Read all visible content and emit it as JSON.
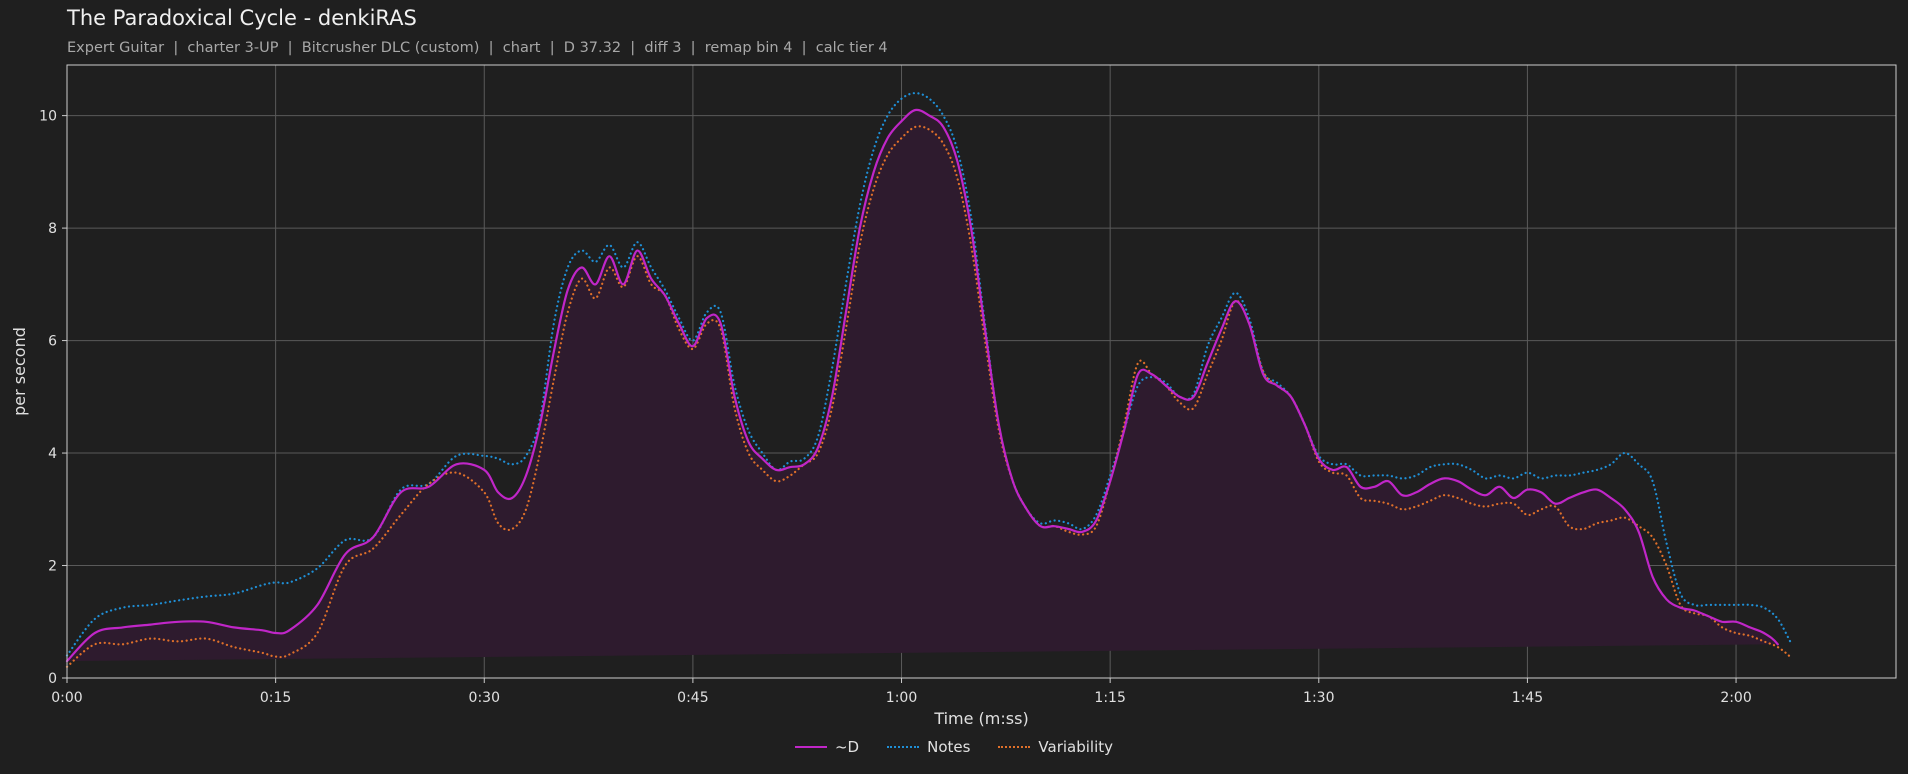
{
  "header": {
    "title": "The Paradoxical Cycle - denkiRAS",
    "subtitle": "Expert Guitar  |  charter 3-UP  |  Bitcrusher DLC (custom)  |  chart  |  D 37.32  |  diff 3  |  remap bin 4  |  calc tier 4"
  },
  "chart_data": {
    "type": "line",
    "xlabel": "Time (m:ss)",
    "ylabel": "per second",
    "xlim": [
      0,
      131.5
    ],
    "ylim": [
      0,
      10.9
    ],
    "x_ticks": [
      0,
      15,
      30,
      45,
      60,
      75,
      90,
      105,
      120
    ],
    "x_tick_labels": [
      "0:00",
      "0:15",
      "0:30",
      "0:45",
      "1:00",
      "1:15",
      "1:30",
      "1:45",
      "2:00"
    ],
    "y_ticks": [
      0,
      2,
      4,
      6,
      8,
      10
    ],
    "y_tick_labels": [
      "0",
      "2",
      "4",
      "6",
      "8",
      "10"
    ],
    "grid": true,
    "legend_position": "bottom-center",
    "x": [
      0,
      2,
      4,
      6,
      8,
      10,
      12,
      14,
      15,
      16,
      18,
      20,
      22,
      24,
      26,
      28,
      30,
      31,
      32,
      33,
      34,
      35,
      36,
      37,
      38,
      39,
      40,
      41,
      42,
      43,
      44,
      45,
      46,
      47,
      48,
      49,
      50,
      51,
      52,
      53,
      54,
      55,
      56,
      57,
      58,
      59,
      60,
      61,
      62,
      63,
      64,
      65,
      66,
      67,
      68,
      69,
      70,
      71,
      72,
      73,
      74,
      75,
      76,
      77,
      78,
      79,
      80,
      81,
      82,
      83,
      84,
      85,
      86,
      87,
      88,
      89,
      90,
      91,
      92,
      93,
      94,
      95,
      96,
      97,
      98,
      99,
      100,
      101,
      102,
      103,
      104,
      105,
      106,
      107,
      108,
      109,
      110,
      111,
      112,
      113,
      114,
      115,
      116,
      117,
      118,
      119,
      120,
      121,
      122,
      123,
      124,
      125,
      126,
      127,
      128,
      129,
      130,
      131.5
    ],
    "series": [
      {
        "name": "~D",
        "color": "#c026c8",
        "style": "solid",
        "fill": "#2e1b2e",
        "values": [
          0.3,
          0.8,
          0.9,
          0.95,
          1.0,
          1.0,
          0.9,
          0.85,
          0.8,
          0.85,
          1.3,
          2.2,
          2.5,
          3.3,
          3.4,
          3.8,
          3.7,
          3.3,
          3.2,
          3.6,
          4.5,
          5.8,
          6.9,
          7.3,
          7.0,
          7.5,
          7.0,
          7.6,
          7.1,
          6.8,
          6.3,
          5.9,
          6.4,
          6.3,
          5.0,
          4.2,
          3.9,
          3.7,
          3.75,
          3.8,
          4.1,
          5.0,
          6.5,
          8.0,
          9.0,
          9.6,
          9.9,
          10.1,
          10.0,
          9.8,
          9.2,
          8.0,
          6.2,
          4.5,
          3.5,
          3.0,
          2.7,
          2.7,
          2.65,
          2.6,
          2.8,
          3.5,
          4.4,
          5.4,
          5.4,
          5.2,
          5.0,
          5.0,
          5.6,
          6.2,
          6.7,
          6.3,
          5.4,
          5.2,
          5.0,
          4.5,
          3.9,
          3.7,
          3.75,
          3.4,
          3.4,
          3.5,
          3.25,
          3.3,
          3.45,
          3.55,
          3.5,
          3.35,
          3.25,
          3.4,
          3.2,
          3.35,
          3.3,
          3.1,
          3.2,
          3.3,
          3.35,
          3.2,
          3.0,
          2.6,
          1.8,
          1.4,
          1.25,
          1.2,
          1.1,
          1.0,
          1.0,
          0.9,
          0.8,
          0.6,
          0.15
        ]
      },
      {
        "name": "Notes",
        "color": "#1f8fd6",
        "style": "dotted",
        "values": [
          0.4,
          1.05,
          1.25,
          1.3,
          1.38,
          1.45,
          1.5,
          1.65,
          1.7,
          1.7,
          1.95,
          2.45,
          2.5,
          3.35,
          3.45,
          3.95,
          3.95,
          3.9,
          3.8,
          3.95,
          4.6,
          6.3,
          7.3,
          7.6,
          7.4,
          7.7,
          7.3,
          7.75,
          7.3,
          6.9,
          6.4,
          6.0,
          6.5,
          6.5,
          5.2,
          4.4,
          4.0,
          3.7,
          3.85,
          3.9,
          4.3,
          5.5,
          7.0,
          8.4,
          9.4,
          10.0,
          10.3,
          10.4,
          10.3,
          10.0,
          9.4,
          8.2,
          6.3,
          4.5,
          3.5,
          3.0,
          2.75,
          2.8,
          2.75,
          2.65,
          2.9,
          3.6,
          4.4,
          5.2,
          5.35,
          5.25,
          5.0,
          5.05,
          5.9,
          6.4,
          6.85,
          6.4,
          5.45,
          5.25,
          5.0,
          4.5,
          3.95,
          3.8,
          3.8,
          3.6,
          3.6,
          3.6,
          3.55,
          3.6,
          3.75,
          3.8,
          3.8,
          3.7,
          3.55,
          3.6,
          3.55,
          3.65,
          3.55,
          3.6,
          3.6,
          3.65,
          3.7,
          3.8,
          4.0,
          3.8,
          3.5,
          2.4,
          1.5,
          1.3,
          1.3,
          1.3,
          1.3,
          1.3,
          1.25,
          1.05,
          0.6,
          0.15
        ]
      },
      {
        "name": "Variability",
        "color": "#e0702a",
        "style": "dotted",
        "values": [
          0.2,
          0.6,
          0.6,
          0.7,
          0.65,
          0.7,
          0.55,
          0.45,
          0.38,
          0.42,
          0.8,
          2.0,
          2.3,
          2.9,
          3.45,
          3.65,
          3.3,
          2.75,
          2.65,
          3.0,
          4.0,
          5.3,
          6.5,
          7.1,
          6.75,
          7.3,
          6.95,
          7.5,
          7.0,
          6.8,
          6.2,
          5.85,
          6.3,
          6.2,
          4.8,
          4.0,
          3.7,
          3.5,
          3.6,
          3.8,
          4.0,
          4.8,
          6.2,
          7.7,
          8.7,
          9.3,
          9.6,
          9.8,
          9.75,
          9.5,
          8.9,
          7.7,
          6.0,
          4.4,
          3.5,
          3.0,
          2.7,
          2.7,
          2.6,
          2.55,
          2.7,
          3.5,
          4.5,
          5.6,
          5.4,
          5.2,
          4.9,
          4.8,
          5.4,
          6.0,
          6.7,
          6.3,
          5.45,
          5.2,
          5.0,
          4.5,
          3.85,
          3.65,
          3.6,
          3.2,
          3.15,
          3.1,
          3.0,
          3.05,
          3.15,
          3.25,
          3.2,
          3.1,
          3.05,
          3.1,
          3.1,
          2.9,
          3.0,
          3.05,
          2.7,
          2.65,
          2.75,
          2.8,
          2.85,
          2.7,
          2.5,
          2.0,
          1.3,
          1.15,
          1.1,
          0.9,
          0.8,
          0.75,
          0.65,
          0.55,
          0.35,
          0.05
        ]
      }
    ]
  }
}
